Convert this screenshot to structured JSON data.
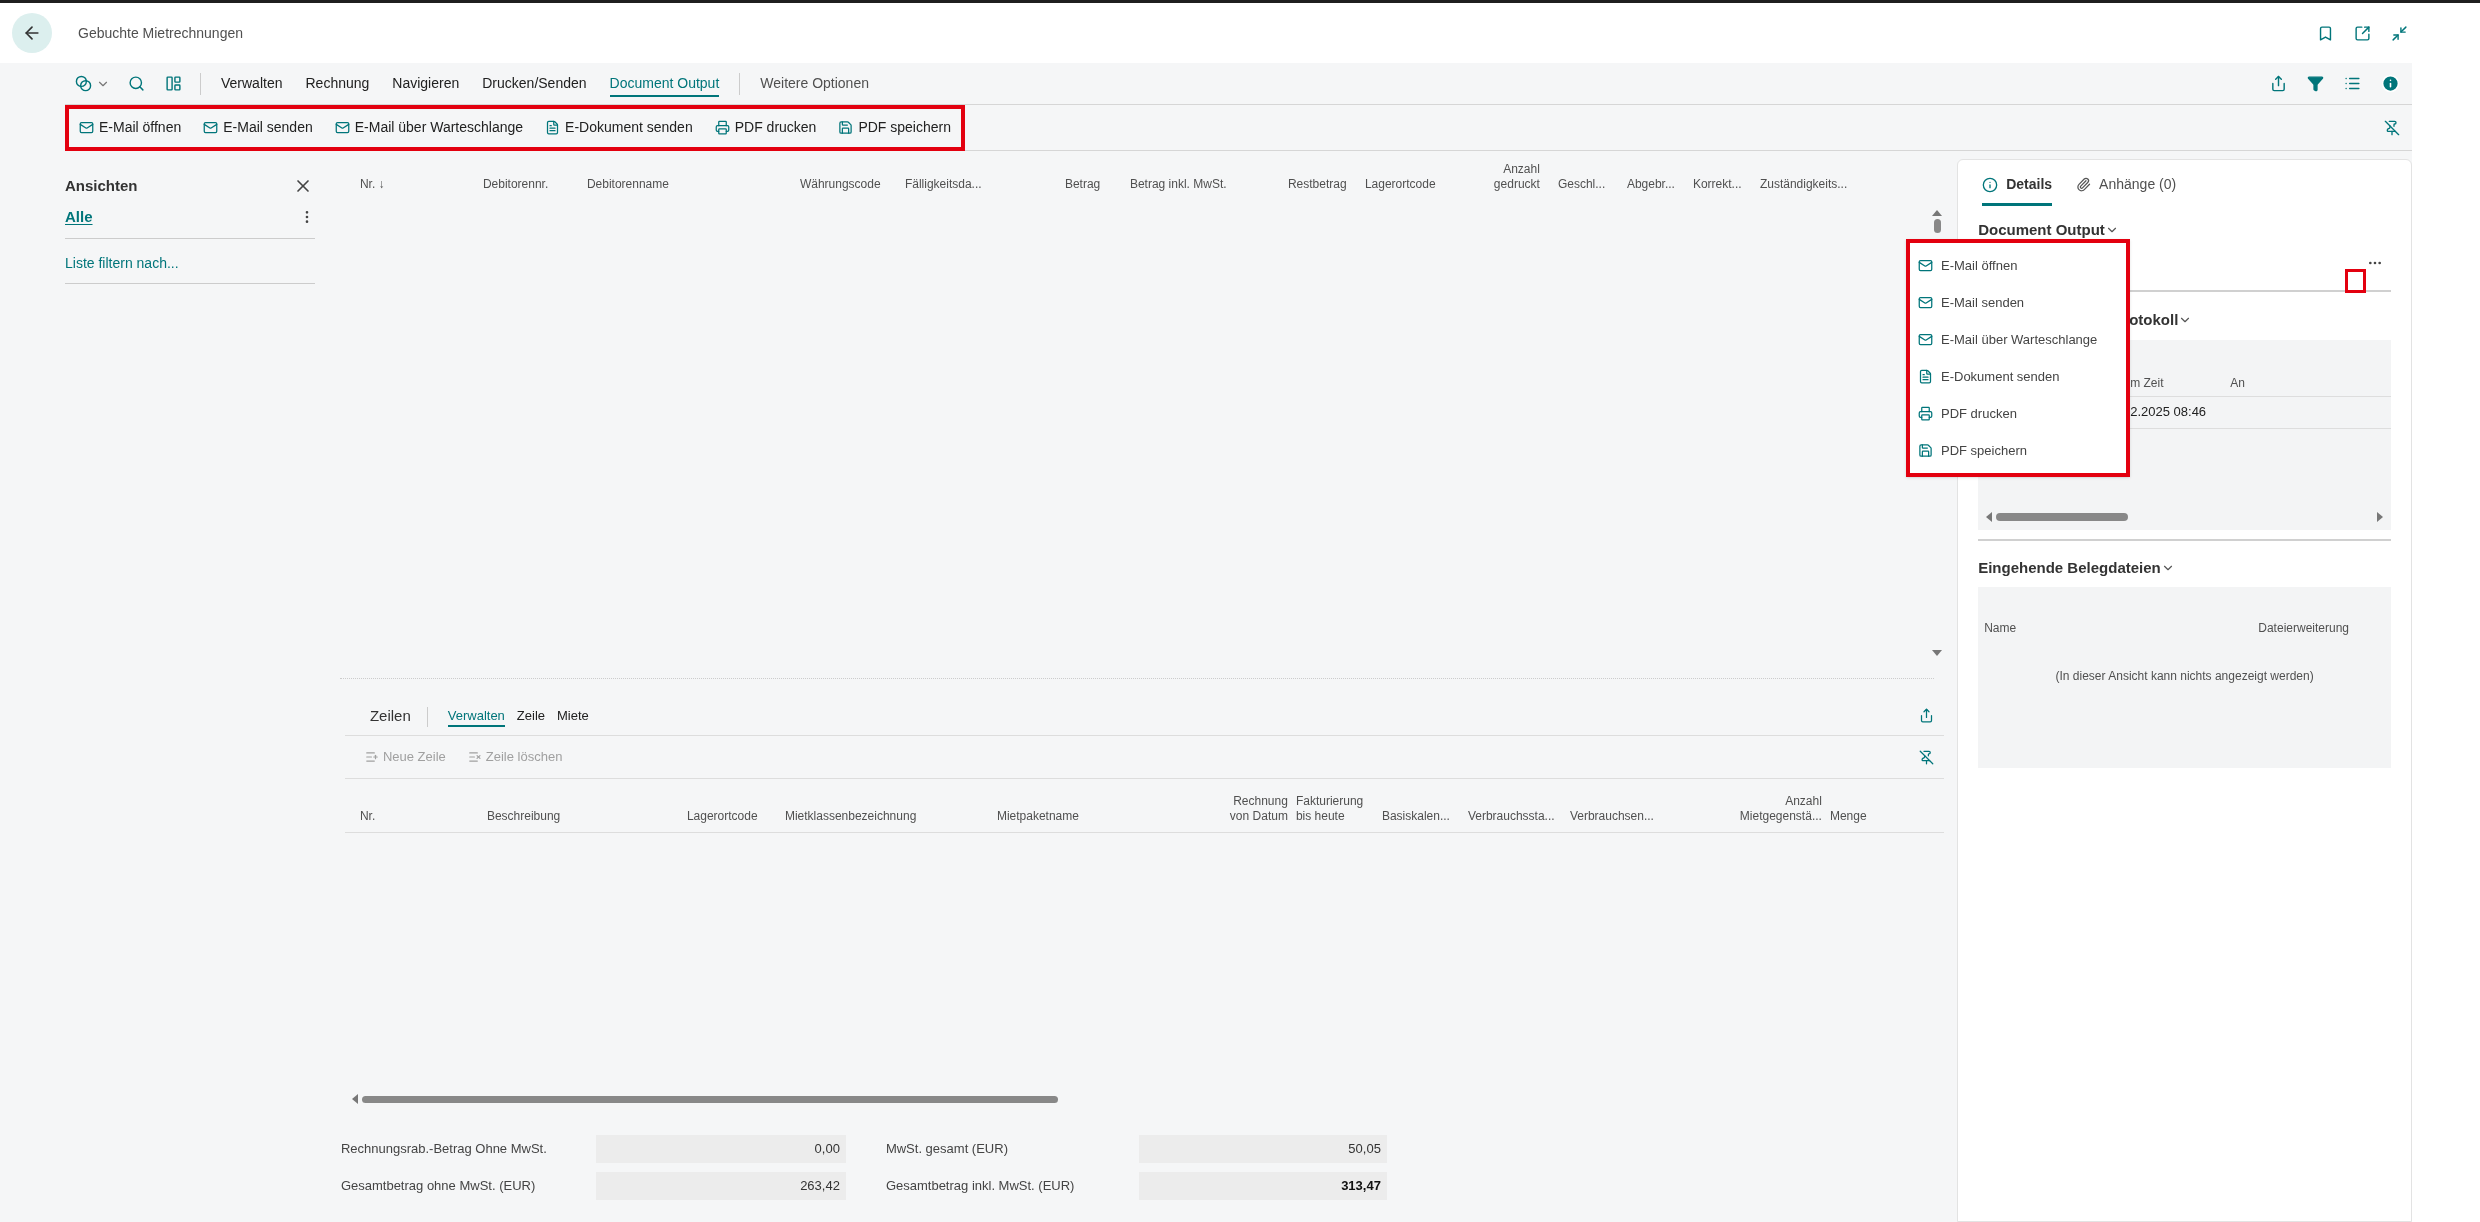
{
  "header": {
    "title": "Gebuchte Mietrechnungen"
  },
  "menu": [
    {
      "label": "Verwalten",
      "selected": false
    },
    {
      "label": "Rechnung",
      "selected": false
    },
    {
      "label": "Navigieren",
      "selected": false
    },
    {
      "label": "Drucken/Senden",
      "selected": false
    },
    {
      "label": "Document Output",
      "selected": true
    }
  ],
  "more_options": "Weitere Optionen",
  "actions": [
    {
      "label": "E-Mail öffnen",
      "kind": "mail"
    },
    {
      "label": "E-Mail senden",
      "kind": "mail"
    },
    {
      "label": "E-Mail über Warteschlange",
      "kind": "mail"
    },
    {
      "label": "E-Dokument senden",
      "kind": "document"
    },
    {
      "label": "PDF drucken",
      "kind": "print"
    },
    {
      "label": "PDF speichern",
      "kind": "save"
    }
  ],
  "views": {
    "title": "Ansichten",
    "items": [
      {
        "label": "Alle",
        "selected": true
      }
    ],
    "filter_link": "Liste filtern nach..."
  },
  "table": {
    "sort_indicator": "↓",
    "columns": [
      "Nr.",
      "Debitorennr.",
      "Debitorenname",
      "Währungscode",
      "Fälligkeitsda...",
      "Betrag",
      "Betrag inkl. MwSt.",
      "Restbetrag",
      "Lagerortcode",
      "Anzahl gedruckt",
      "Geschl...",
      "Abgebr...",
      "Korrekt...",
      "Zuständigkeits..."
    ]
  },
  "dropdown": {
    "items": [
      {
        "label": "E-Mail öffnen",
        "kind": "mail"
      },
      {
        "label": "E-Mail senden",
        "kind": "mail"
      },
      {
        "label": "E-Mail über Warteschlange",
        "kind": "mail"
      },
      {
        "label": "E-Dokument senden",
        "kind": "document"
      },
      {
        "label": "PDF drucken",
        "kind": "print"
      },
      {
        "label": "PDF speichern",
        "kind": "save"
      }
    ]
  },
  "lines": {
    "title": "Zeilen",
    "tabs": [
      {
        "label": "Verwalten",
        "selected": true
      },
      {
        "label": "Zeile",
        "selected": false
      },
      {
        "label": "Miete",
        "selected": false
      }
    ],
    "toolbar": [
      {
        "label": "Neue Zeile",
        "kind": "add",
        "disabled": true
      },
      {
        "label": "Zeile löschen",
        "kind": "delete",
        "disabled": true
      }
    ],
    "columns": [
      "Nr.",
      "Beschreibung",
      "Lagerortcode",
      "Mietklassenbezeichnung",
      "Mietpaketname",
      "Rechnung von Datum",
      "Fakturierung bis heute",
      "Basiskalen...",
      "Verbrauchssta...",
      "Verbrauchsen...",
      "Anzahl Mietgegenstä...",
      "Menge"
    ]
  },
  "totals": [
    {
      "label": "Rechnungsrab.-Betrag Ohne MwSt.",
      "value": "0,00",
      "emphasized": false
    },
    {
      "label": "MwSt. gesamt (EUR)",
      "value": "50,05",
      "emphasized": false
    },
    {
      "label": "Gesamtbetrag ohne MwSt. (EUR)",
      "value": "263,42",
      "emphasized": false
    },
    {
      "label": "Gesamtbetrag inkl. MwSt. (EUR)",
      "value": "313,47",
      "emphasized": true
    }
  ],
  "factbox": {
    "tabs": [
      {
        "label": "Details",
        "kind": "info",
        "selected": true
      },
      {
        "label": "Anhänge (0)",
        "kind": "attachment",
        "selected": false
      }
    ],
    "document_output": {
      "title": "Document Output"
    },
    "log": {
      "title": "otokoll",
      "columns": [
        "m Zeit",
        "An"
      ],
      "rows": [
        [
          "2.2025 08:46"
        ]
      ]
    },
    "incoming": {
      "title": "Eingehende Belegdateien",
      "columns": [
        "Name",
        "Dateierweiterung"
      ],
      "empty_text": "(In dieser Ansicht kann nichts angezeigt werden)"
    }
  }
}
